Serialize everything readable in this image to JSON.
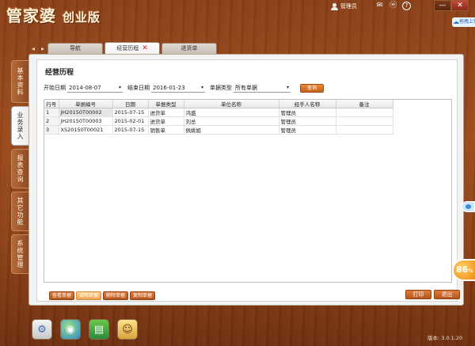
{
  "app": {
    "title_main": "管家婆",
    "title_sub": "创业版",
    "user": "管理员",
    "side_widget": "拖拽上传"
  },
  "tabs": [
    {
      "label": "导航",
      "active": false
    },
    {
      "label": "经营历程",
      "active": true
    },
    {
      "label": "进货单",
      "active": false
    }
  ],
  "side_tabs": [
    "基本资料",
    "业务录入",
    "报表查询",
    "其它功能",
    "系统管理"
  ],
  "page": {
    "title": "经营历程",
    "filters": {
      "start_label": "开始日期",
      "start_value": "2014-08-07",
      "end_label": "结束日期",
      "end_value": "2016-01-23",
      "type_label": "单据类型",
      "type_value": "所有单据",
      "query_button": "查询"
    }
  },
  "table": {
    "headers": [
      "行号",
      "单据编号",
      "日期",
      "单据类型",
      "单位名称",
      "经手人名称",
      "备注"
    ],
    "rows": [
      [
        "1",
        "JH20150T00002",
        "2015-07-15",
        "进货单",
        "鸿盛",
        "管理员",
        ""
      ],
      [
        "2",
        "JH20150T00003",
        "2015-02-01",
        "进货单",
        "刘总",
        "管理员",
        ""
      ],
      [
        "3",
        "XS20150T00021",
        "2015-07-15",
        "销售单",
        "佩姚姐",
        "管理员",
        ""
      ]
    ]
  },
  "bottom_buttons": [
    "查看单据",
    "调用单据",
    "删除单据",
    "复制单据"
  ],
  "right_buttons": [
    "打印",
    "退出"
  ],
  "badge": {
    "value": "86",
    "unit": "%"
  },
  "version": "版本: 3.0.1.20",
  "colors": {
    "wood": "#8a3f16",
    "accent_button": "#c4601a",
    "tab_close": "#dd2222"
  }
}
